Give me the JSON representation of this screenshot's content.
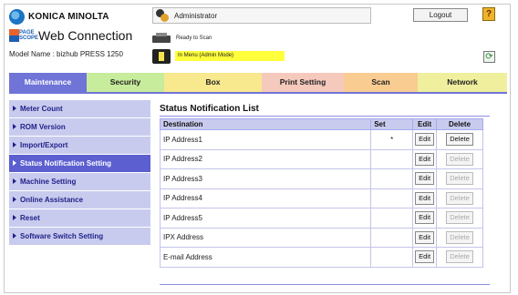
{
  "brand": {
    "name": "KONICA MINOLTA",
    "app_title": "Web Connection",
    "logo_small": "PAGE SCOPE",
    "model": "Model Name : bizhub PRESS 1250"
  },
  "header": {
    "user": "Administrator",
    "logout_label": "Logout",
    "help_label": "?",
    "status_ready": "Ready to Scan",
    "status_mode": "In Menu (Admin Mode)"
  },
  "tabs": [
    "Maintenance",
    "Security",
    "Box",
    "Print Setting",
    "Scan",
    "Network"
  ],
  "sidebar": {
    "items": [
      "Meter Count",
      "ROM Version",
      "Import/Export",
      "Status Notification Setting",
      "Machine Setting",
      "Online Assistance",
      "Reset",
      "Software Switch Setting"
    ],
    "active_index": 3
  },
  "main": {
    "title": "Status Notification List",
    "columns": [
      "Destination",
      "Set",
      "Edit",
      "Delete"
    ],
    "rows": [
      {
        "destination": "IP Address1",
        "set": "*",
        "edit": "Edit",
        "delete": "Delete",
        "delete_enabled": true
      },
      {
        "destination": "IP Address2",
        "set": "",
        "edit": "Edit",
        "delete": "Delete",
        "delete_enabled": false
      },
      {
        "destination": "IP Address3",
        "set": "",
        "edit": "Edit",
        "delete": "Delete",
        "delete_enabled": false
      },
      {
        "destination": "IP Address4",
        "set": "",
        "edit": "Edit",
        "delete": "Delete",
        "delete_enabled": false
      },
      {
        "destination": "IP Address5",
        "set": "",
        "edit": "Edit",
        "delete": "Delete",
        "delete_enabled": false
      },
      {
        "destination": "IPX Address",
        "set": "",
        "edit": "Edit",
        "delete": "Delete",
        "delete_enabled": false
      },
      {
        "destination": "E-mail Address",
        "set": "",
        "edit": "Edit",
        "delete": "Delete",
        "delete_enabled": false
      }
    ]
  },
  "colors": {
    "maintenance_tab": "#6f74d6",
    "sidebar_active": "#5b5fd0",
    "sidebar_bg": "#c9cbee",
    "mode_highlight": "#ffff3b"
  }
}
